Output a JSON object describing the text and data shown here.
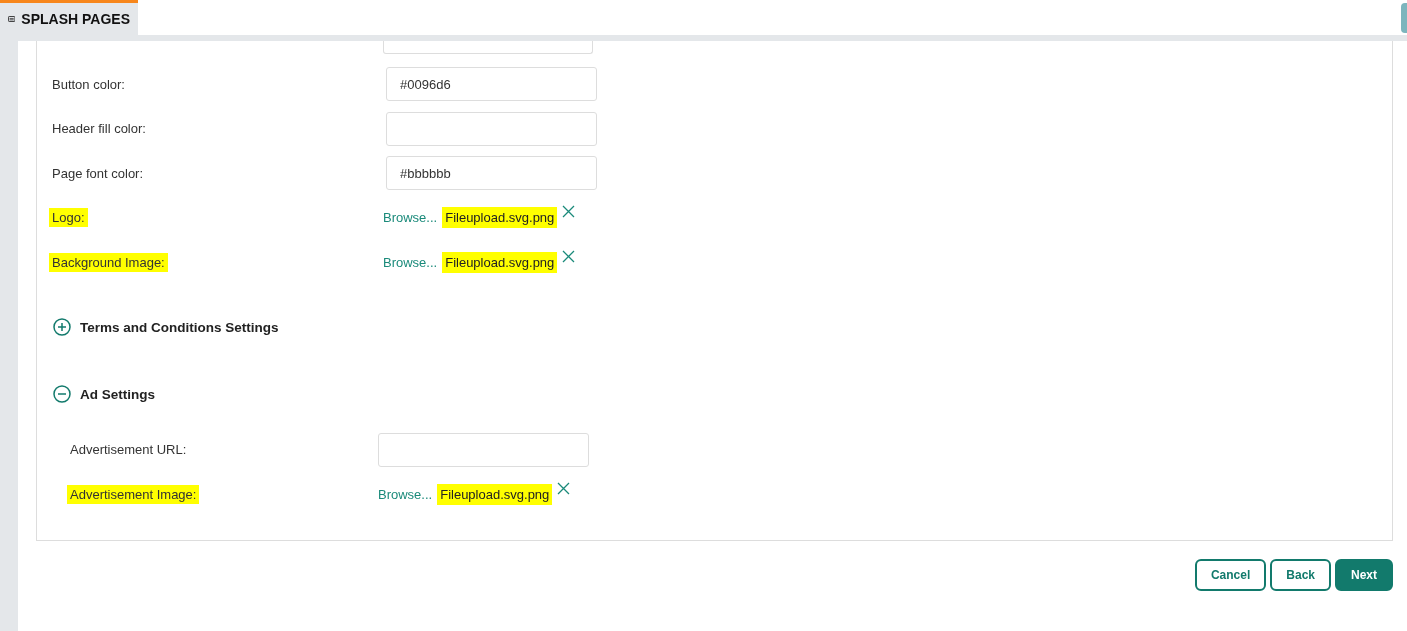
{
  "tab": {
    "label": "SPLASH PAGES",
    "selected": true
  },
  "color_fields": [
    {
      "label": "Button color:",
      "value": "#0096d6"
    },
    {
      "label": "Header fill color:"
    },
    {
      "label": "Page font color:",
      "value": "#bbbbbb"
    }
  ],
  "uploads": [
    {
      "label": "Logo:",
      "highlighted": true,
      "browse": "Browse...",
      "file": "Fileupload.svg.png",
      "file_highlighted": true
    },
    {
      "label": "Background Image:",
      "highlighted": true,
      "browse": "Browse...",
      "file": "Fileupload.svg.png",
      "file_highlighted": true
    }
  ],
  "sections": [
    {
      "title": "Terms and Conditions Settings",
      "expanded": false
    },
    {
      "title": "Ad Settings",
      "expanded": true,
      "fields": [
        {
          "kind": "text",
          "label": "Advertisement URL:",
          "highlighted": false
        },
        {
          "kind": "upload",
          "label": "Advertisement Image:",
          "highlighted": true,
          "browse": "Browse...",
          "file": "Fileupload.svg.png",
          "file_highlighted": true
        }
      ]
    }
  ],
  "buttons": [
    {
      "label": "Cancel",
      "primary": false
    },
    {
      "label": "Back",
      "primary": false
    },
    {
      "label": "Next",
      "primary": true
    }
  ]
}
